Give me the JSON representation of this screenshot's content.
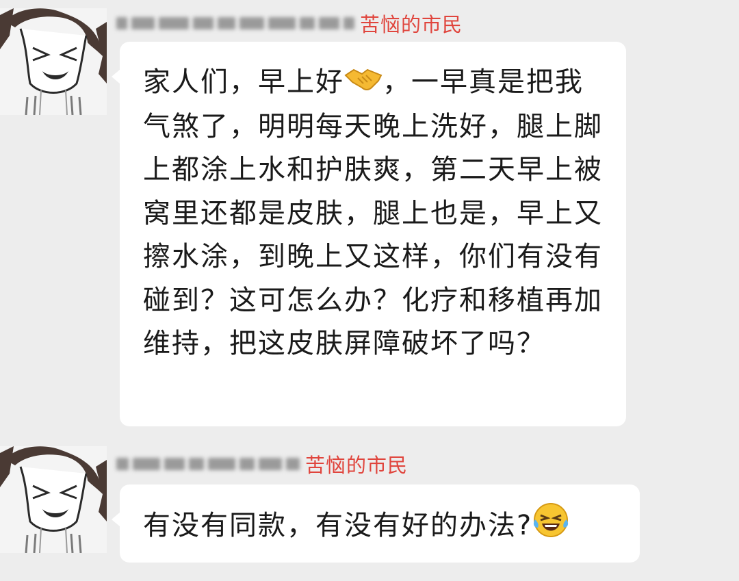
{
  "messages": [
    {
      "sender_role": "苦恼的市民",
      "avatar_icon": "crying-girl-avatar-icon",
      "text_before_emoji": "家人们，早上好",
      "emoji": "handshake-emoji",
      "text_after_emoji": "，一早真是把我气煞了，明明每天晚上洗好，腿上脚上都涂上水和护肤爽，第二天早上被窝里还都是皮肤，腿上也是，早上又擦水涂，到晚上又这样，你们有没有碰到？这可怎么办？化疗和移植再加维持，把这皮肤屏障破坏了吗？"
    },
    {
      "sender_role": "苦恼的市民",
      "avatar_icon": "crying-girl-avatar-icon",
      "text_before_emoji": "有没有同款，有没有好的办法?",
      "emoji": "laughing-tears-emoji",
      "text_after_emoji": ""
    }
  ],
  "colors": {
    "background": "#ededed",
    "bubble": "#ffffff",
    "sender_role": "#e0453d",
    "text": "#1a1a1a"
  }
}
